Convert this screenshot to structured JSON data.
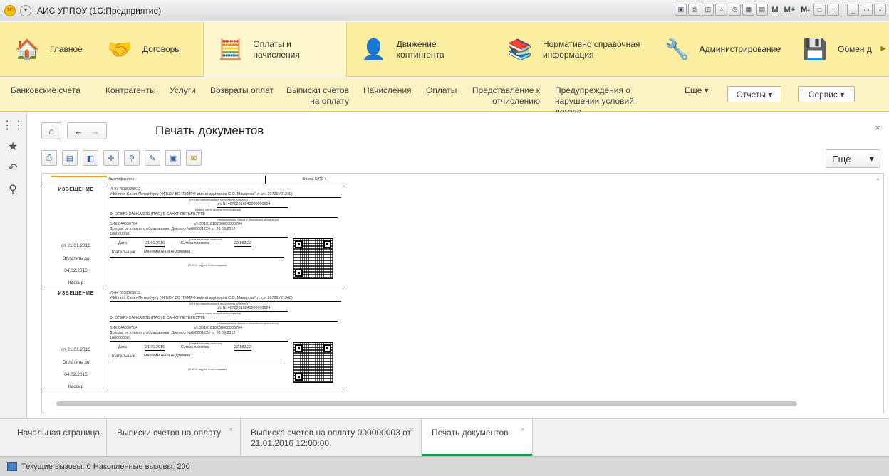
{
  "window": {
    "title": "АИС УППОУ (1С:Предприятие)",
    "toolbar_text_buttons": [
      "M",
      "M+",
      "M-"
    ]
  },
  "sections": [
    {
      "label": "Главное",
      "icon": "home-section-icon"
    },
    {
      "label": "Договоры",
      "icon": "handshake-icon"
    },
    {
      "label": "Оплаты и начисления",
      "icon": "abacus-icon"
    },
    {
      "label": "Движение контингента",
      "icon": "student-icon"
    },
    {
      "label": "Нормативно справочная информация",
      "icon": "binders-icon"
    },
    {
      "label": "Администрирование",
      "icon": "tools-icon"
    },
    {
      "label": "Обмен д",
      "icon": "exchange-icon"
    }
  ],
  "commands": {
    "bank_accounts": "Банковские счета",
    "counterparties": "Контрагенты",
    "services": "Услуги",
    "refunds": "Возвраты оплат",
    "invoice_statements": "Выписки счетов на оплату",
    "accruals": "Начисления",
    "payments": "Оплаты",
    "expulsion": "Представление к отчислению",
    "warnings": "Предупреждения о нарушении условий догово...",
    "more": "Еще ▾",
    "reports": "Отчеты ▾",
    "service": "Сервис ▾"
  },
  "form": {
    "title": "Печать документов",
    "more_label": "Еще",
    "close": "×"
  },
  "receipt": {
    "identifier_label": "Идентификатор",
    "form_label": "Форма N ПД-4",
    "notice": "ИЗВЕЩЕНИЕ",
    "date_from": "от 21.01.2016",
    "pay_by_label": "Оплатить до",
    "pay_by_date": "04.02.2016",
    "cashier": "Кассир",
    "inn": "ИНН 7838028012",
    "payee": "УФК по г. Санкт-Петербургу (ФГБОУ ВО \"ГУМРФ имени адмирала С.О. Макарова\" л. сч. 20726У21340)",
    "payee_caption": "(ИНН и наименование получателя платежа)",
    "account": "р/с N: 40702810240000000624",
    "account_caption": "(номер счета получателя платежа)",
    "bank": "Ф. ОПЕРУ БАНКА ВТБ (ПАО) В САНКТ-ПЕТЕРБУРГЕ",
    "bank_caption": "(наименование банка и банковские реквизиты)",
    "bik": "БИК 044030704",
    "corr": "к/с 30101810200000000704",
    "purpose": "Доходы от платного образования. Договор №00000122б от 20.09.2012",
    "code": "1600000001",
    "payment_caption": "(наименование платежа)",
    "date_label": "Дата",
    "date_value": "21.01.2016",
    "sum_label": "Сумма платежа",
    "sum_value": "22 882,22",
    "payer_label": "Плательщик",
    "payer_name": "Мангейм Анна Андреевна",
    "payer_caption": "(Ф.И.О., адрес плательщика)"
  },
  "tabs": [
    {
      "label": "Начальная страница",
      "closable": false,
      "active": false
    },
    {
      "label": "Выписки счетов на оплату",
      "closable": true,
      "active": false
    },
    {
      "label": "Выписка счетов на оплату 000000003 от 21.01.2016 12:00:00",
      "closable": true,
      "active": false
    },
    {
      "label": "Печать документов",
      "closable": true,
      "active": true
    }
  ],
  "status": {
    "text": "Текущие вызовы: 0   Накопленные вызовы: 200"
  },
  "colors": {
    "sections_bg": "#fbeea0",
    "commands_bg": "#fcf3c4",
    "active_tab_bar": "#1b9a4b"
  }
}
